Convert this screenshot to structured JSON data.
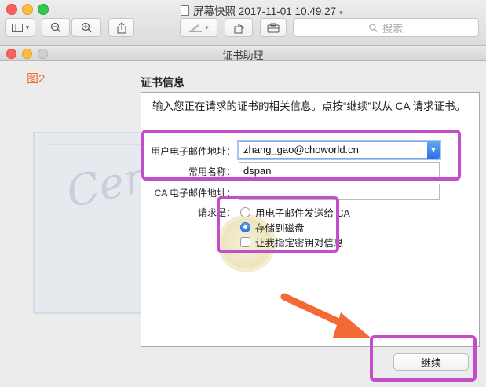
{
  "preview": {
    "title": "屏幕快照 2017-11-01 10.49.27",
    "search_placeholder": "搜索",
    "toolbar_icons": [
      "sidebar-icon",
      "zoom-out-icon",
      "zoom-in-icon",
      "share-icon",
      "markup-icon",
      "rotate-icon",
      "toolbox-icon"
    ]
  },
  "assistant": {
    "window_title": "证书助理",
    "annotation": "图2",
    "section_title": "证书信息",
    "intro": "输入您正在请求的证书的相关信息。点按“继续”以从 CA 请求证书。",
    "fields": [
      {
        "label": "用户电子邮件地址：",
        "value": "zhang_gao@choworld.cn"
      },
      {
        "label": "常用名称：",
        "value": "dspan"
      },
      {
        "label": "CA 电子邮件地址：",
        "value": ""
      }
    ],
    "request_label": "请求是：",
    "options": [
      {
        "label": "用电子邮件发送给 CA",
        "selected": false
      },
      {
        "label": "存储到磁盘",
        "selected": true
      }
    ],
    "checkbox_label": "让我指定密钥对信息",
    "checkbox_checked": false,
    "continue_label": "继续",
    "watermark_text": "Certif"
  },
  "colors": {
    "highlight": "#c44ec9",
    "arrow": "#f26b35",
    "annotation": "#f06a32",
    "accent": "#2f78e8"
  }
}
